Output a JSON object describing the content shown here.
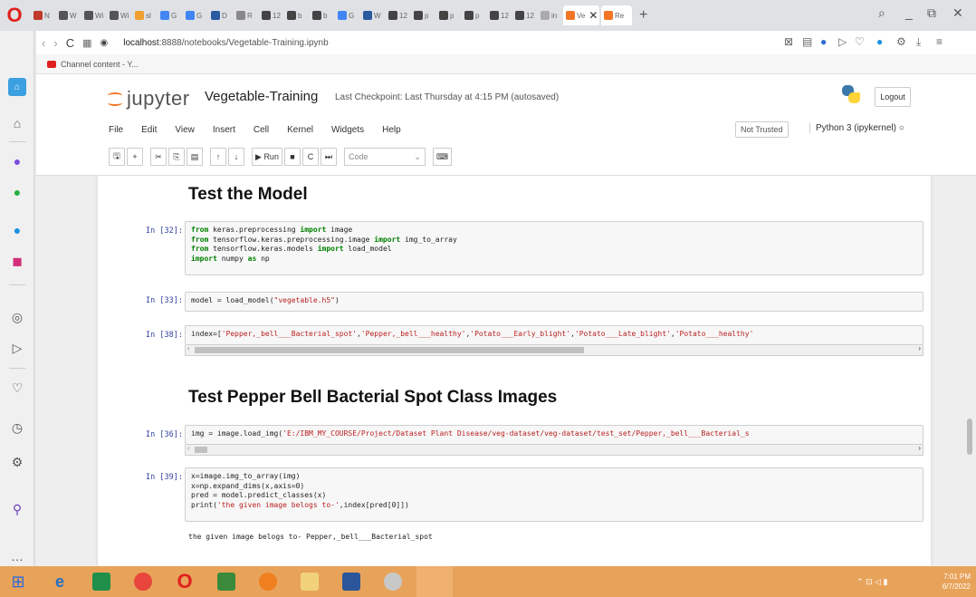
{
  "browser": {
    "tabs": [
      {
        "label": "N",
        "color": "#c0392b"
      },
      {
        "label": "W",
        "color": "#555555"
      },
      {
        "label": "Wi",
        "color": "#555555"
      },
      {
        "label": "Wi",
        "color": "#555555"
      },
      {
        "label": "sl",
        "color": "#f0a030"
      },
      {
        "label": "G",
        "color": "#4285f4"
      },
      {
        "label": "G",
        "color": "#4285f4"
      },
      {
        "label": "D",
        "color": "#2c5aa0"
      },
      {
        "label": "R",
        "color": "#888888"
      },
      {
        "label": "12",
        "color": "#444444"
      },
      {
        "label": "b",
        "color": "#444444"
      },
      {
        "label": "b",
        "color": "#444444"
      },
      {
        "label": "G",
        "color": "#4285f4"
      },
      {
        "label": "W",
        "color": "#2c5aa0"
      },
      {
        "label": "12",
        "color": "#444444"
      },
      {
        "label": "p",
        "color": "#444444"
      },
      {
        "label": "p",
        "color": "#444444"
      },
      {
        "label": "p",
        "color": "#444444"
      },
      {
        "label": "12",
        "color": "#444444"
      },
      {
        "label": "12",
        "color": "#444444"
      },
      {
        "label": "in",
        "color": "#aaaaaa"
      }
    ],
    "url_host": "localhost",
    "url_path": ":8888/notebooks/Vegetable-Training.ipynb",
    "bookmark": "Channel content - Y..."
  },
  "jupyter": {
    "logo_text": "jupyter",
    "notebook_name": "Vegetable-Training",
    "checkpoint": "Last Checkpoint: Last Thursday at 4:15 PM  (autosaved)",
    "logout_label": "Logout",
    "menu": [
      "File",
      "Edit",
      "View",
      "Insert",
      "Cell",
      "Kernel",
      "Widgets",
      "Help"
    ],
    "not_trusted": "Not Trusted",
    "kernel": "Python 3 (ipykernel)",
    "run_label": "Run",
    "cell_type": "Code"
  },
  "notebook": {
    "heading1": "Test the Model",
    "heading2": "Test Pepper Bell Bacterial Spot Class Images",
    "cells": [
      {
        "prompt": "In [32]:"
      },
      {
        "prompt": "In [33]:"
      },
      {
        "prompt": "In [38]:"
      },
      {
        "prompt": "In [36]:"
      },
      {
        "prompt": "In [39]:"
      }
    ],
    "output": "the given image belogs to- Pepper,_bell___Bacterial_spot"
  },
  "taskbar": {
    "time": "7:01 PM",
    "date": "6/7/2022"
  }
}
